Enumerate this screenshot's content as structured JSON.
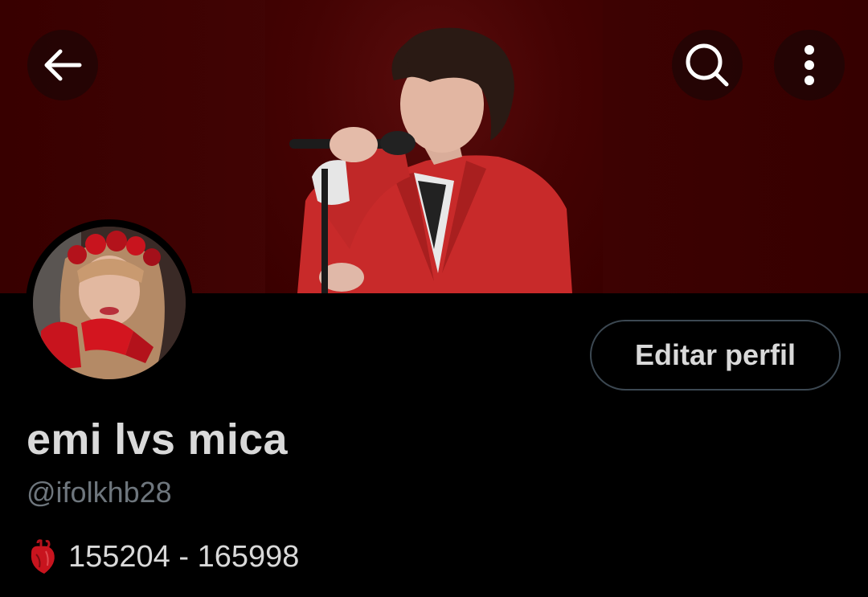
{
  "banner": {
    "alt": "profile header image"
  },
  "nav": {
    "back_icon": "arrow-left-icon",
    "search_icon": "search-icon",
    "more_icon": "more-vertical-icon"
  },
  "profile": {
    "edit_label": "Editar perfil",
    "display_name": "emi lvs mica",
    "handle": "@ifolkhb28",
    "bio_icon": "anatomical-heart-emoji",
    "bio_text": "155204 - 165998"
  },
  "colors": {
    "background": "#000000",
    "banner_red": "#3a0000",
    "text_primary": "#d9d9d9",
    "text_secondary": "#6e767d",
    "button_border": "#3c4852"
  }
}
